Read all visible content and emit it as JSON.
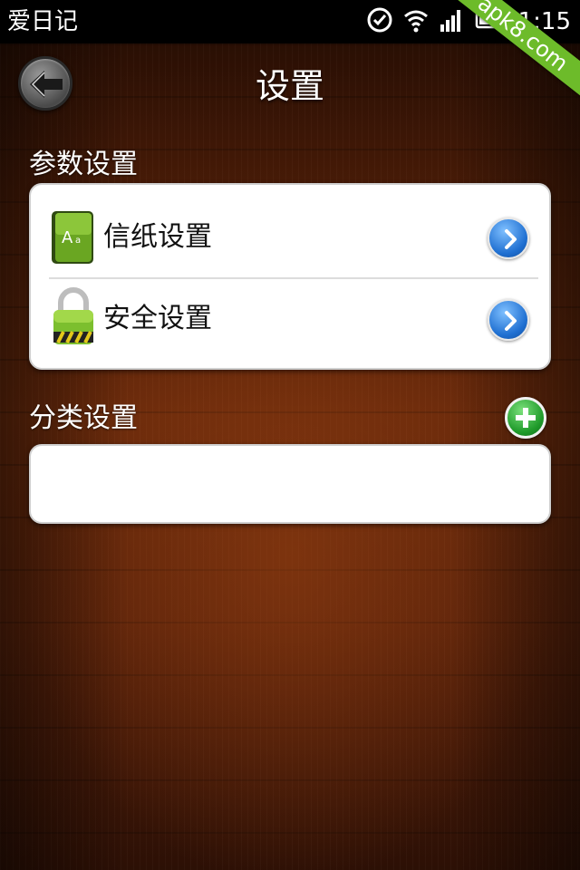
{
  "status_bar": {
    "app_name": "爱日记",
    "time": "1:15",
    "watermark": "apk8.com"
  },
  "header": {
    "title": "设置"
  },
  "sections": {
    "params": {
      "label": "参数设置",
      "items": [
        {
          "label": "信纸设置",
          "icon": "stationery-icon"
        },
        {
          "label": "安全设置",
          "icon": "lock-icon"
        }
      ]
    },
    "categories": {
      "label": "分类设置",
      "items": []
    }
  },
  "colors": {
    "accent_blue": "#1f6fd1",
    "accent_green": "#1f9a2a",
    "wood_dark": "#3a1606",
    "wood_mid": "#6b2a0b"
  }
}
